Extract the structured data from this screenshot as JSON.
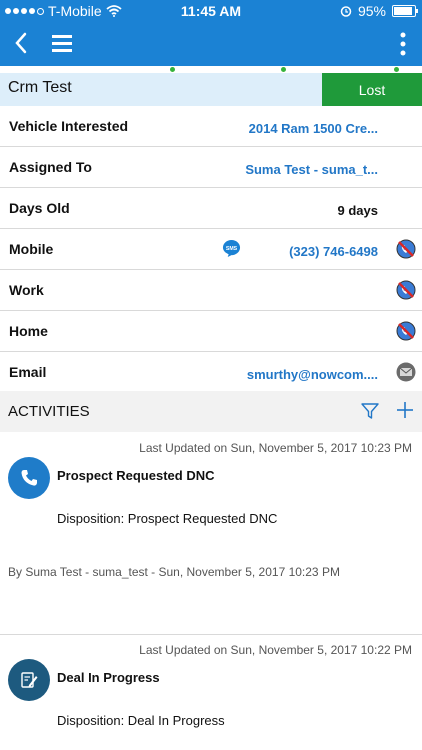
{
  "status_bar": {
    "carrier": "T-Mobile",
    "time": "11:45 AM",
    "battery": "95%"
  },
  "lead": {
    "name": "Crm Test",
    "status": "Lost"
  },
  "fields": [
    {
      "label": "Vehicle Interested",
      "value": "2014 Ram 1500 Cre..."
    },
    {
      "label": "Assigned To",
      "value": "Suma Test - suma_t..."
    },
    {
      "label": "Days Old",
      "value": "9 days"
    },
    {
      "label": "Mobile",
      "value": "(323) 746-6498"
    },
    {
      "label": "Work",
      "value": ""
    },
    {
      "label": "Home",
      "value": ""
    },
    {
      "label": "Email",
      "value": "smurthy@nowcom...."
    }
  ],
  "sms_badge": "SMS",
  "activities": {
    "title": "ACTIVITIES",
    "items": [
      {
        "updated": "Last Updated on Sun, November 5, 2017 10:23 PM",
        "heading": "Prospect Requested DNC",
        "disposition": "Disposition: Prospect Requested DNC",
        "by": "By Suma Test - suma_test - Sun, November 5, 2017 10:23 PM",
        "icon": "phone-icon"
      },
      {
        "updated": "Last Updated on Sun, November 5, 2017 10:22 PM",
        "heading": "Deal In Progress",
        "disposition": "Disposition: Deal In Progress",
        "icon": "note-icon"
      }
    ]
  },
  "colors": {
    "primary": "#1b82d4",
    "link": "#2277c7",
    "lost": "#1f9a3a",
    "header_bg": "#ddeefa"
  }
}
